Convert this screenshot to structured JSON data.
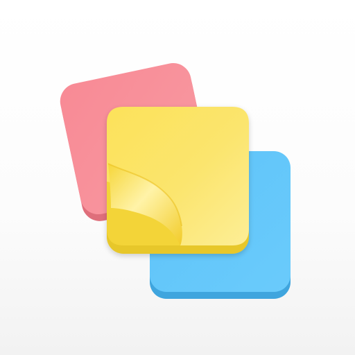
{
  "app_icon": {
    "icon_name": "sticky-notes-icon",
    "colors": {
      "pink_note": "#F88E98",
      "pink_note_shadow": "#DF6F7B",
      "yellow_note": "#FBE46C",
      "yellow_note_shadow": "#E7C72A",
      "blue_note": "#62C6FA",
      "blue_note_shadow": "#3FA5DE",
      "background": "#FFFFFF"
    }
  }
}
